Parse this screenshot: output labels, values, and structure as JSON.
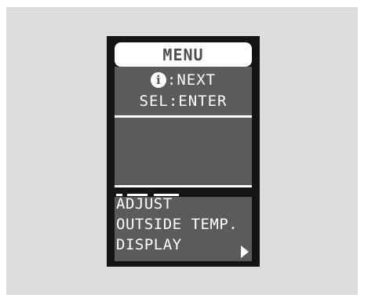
{
  "screen": {
    "title": "MENU",
    "info_icon": "i",
    "line1": ":NEXT",
    "line2": "SEL:ENTER"
  },
  "menu": {
    "lines": [
      "ADJUST",
      "OUTSIDE TEMP.",
      "DISPLAY"
    ],
    "arrow_icon": "triangle-right-icon"
  },
  "colors": {
    "panel_bg": "#dcdcdc",
    "bezel": "#141414",
    "screen_bg": "#5b5b5b",
    "text": "#ffffff"
  }
}
